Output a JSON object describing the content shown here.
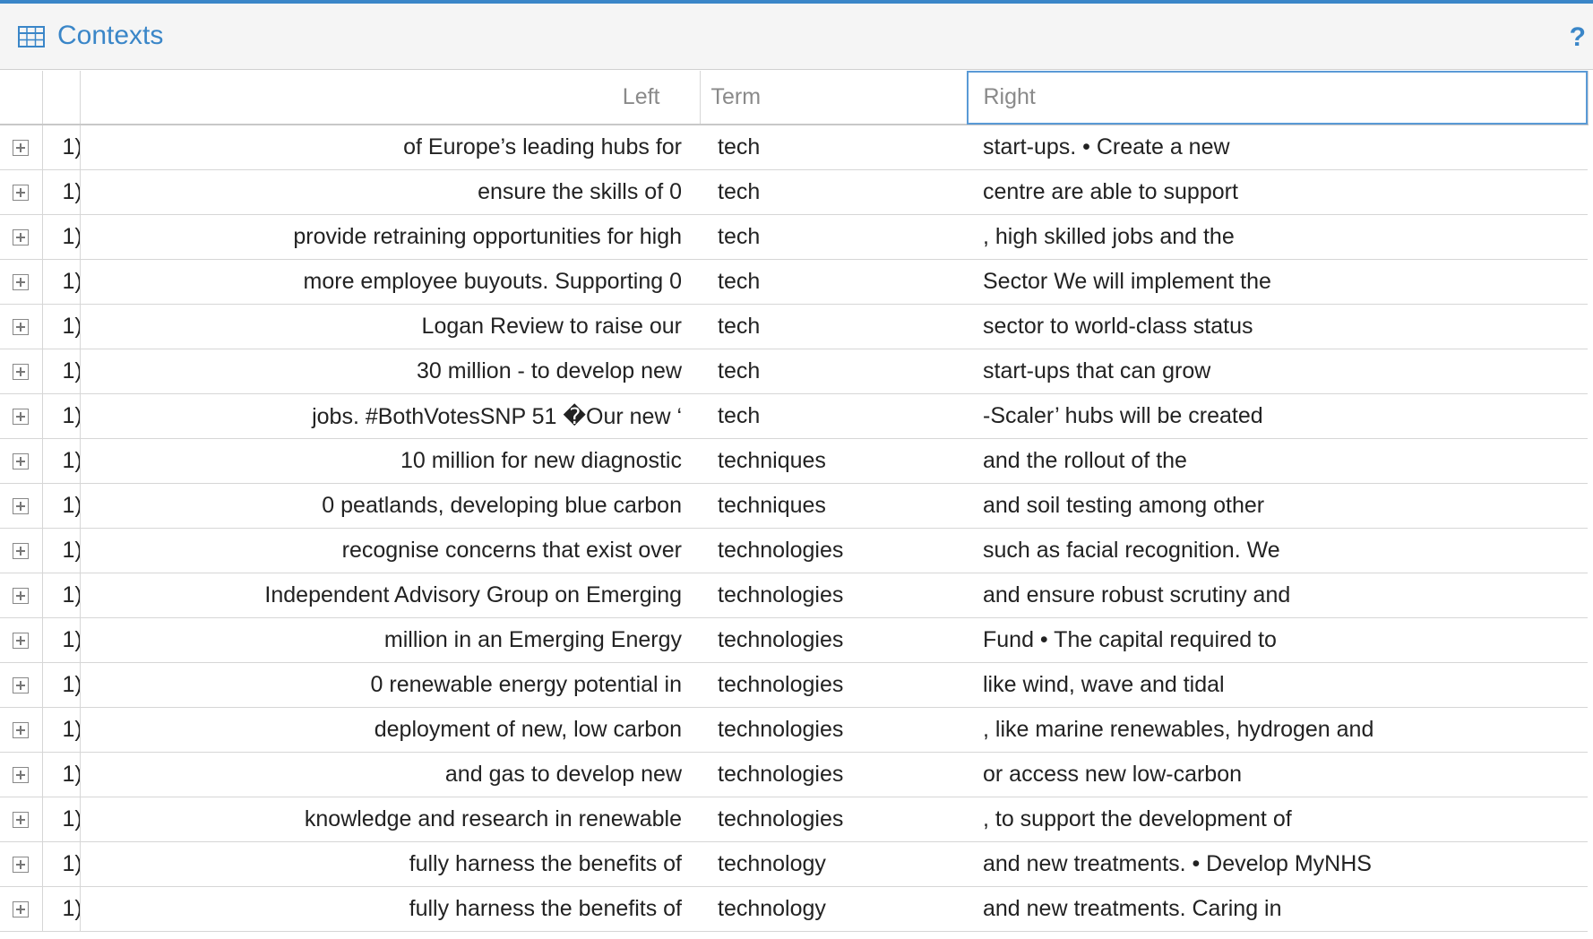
{
  "panel": {
    "title": "Contexts",
    "help_label": "?",
    "accent_color": "#3a86c8",
    "icon": "table-grid-icon"
  },
  "columns": {
    "left": "Left",
    "term": "Term",
    "right": "Right"
  },
  "rows": [
    {
      "num": "1)",
      "left": "of Europe’s leading hubs for",
      "term": "tech",
      "right": "start-ups. • Create a new"
    },
    {
      "num": "1)",
      "left": "ensure the skills of 0",
      "term": "tech",
      "right": "centre are able to support"
    },
    {
      "num": "1)",
      "left": "provide retraining opportunities for high",
      "term": "tech",
      "right": ", high skilled jobs and the"
    },
    {
      "num": "1)",
      "left": "more employee buyouts. Supporting 0",
      "term": "tech",
      "right": "Sector We will implement the"
    },
    {
      "num": "1)",
      "left": "Logan Review to raise our",
      "term": "tech",
      "right": "sector to world-class status"
    },
    {
      "num": "1)",
      "left": "30 million - to develop new",
      "term": "tech",
      "right": "start-ups that can grow"
    },
    {
      "num": "1)",
      "left": "jobs. #BothVotesSNP 51 �Our new ‘",
      "term": "tech",
      "right": "-Scaler’ hubs will be created"
    },
    {
      "num": "1)",
      "left": "10 million for new diagnostic",
      "term": "techniques",
      "right": "and the rollout of the"
    },
    {
      "num": "1)",
      "left": "0 peatlands, developing blue carbon",
      "term": "techniques",
      "right": "and soil testing among other"
    },
    {
      "num": "1)",
      "left": "recognise concerns that exist over",
      "term": "technologies",
      "right": "such as facial recognition. We"
    },
    {
      "num": "1)",
      "left": "Independent Advisory Group on Emerging",
      "term": "technologies",
      "right": "and ensure robust scrutiny and"
    },
    {
      "num": "1)",
      "left": "million in an Emerging Energy",
      "term": "technologies",
      "right": "Fund • The capital required to"
    },
    {
      "num": "1)",
      "left": "0 renewable energy potential in",
      "term": "technologies",
      "right": "like wind, wave and tidal"
    },
    {
      "num": "1)",
      "left": "deployment of new, low carbon",
      "term": "technologies",
      "right": ", like marine renewables, hydrogen and"
    },
    {
      "num": "1)",
      "left": "and gas to develop new",
      "term": "technologies",
      "right": "or access new low-carbon"
    },
    {
      "num": "1)",
      "left": "knowledge and research in renewable",
      "term": "technologies",
      "right": ", to support the development of"
    },
    {
      "num": "1)",
      "left": "fully harness the benefits of",
      "term": "technology",
      "right": "and new treatments. • Develop MyNHS"
    },
    {
      "num": "1)",
      "left": "fully harness the benefits of",
      "term": "technology",
      "right": "and new treatments. Caring in"
    }
  ]
}
